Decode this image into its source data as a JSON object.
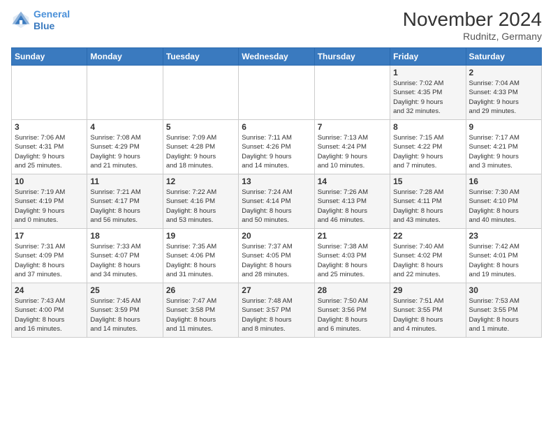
{
  "logo": {
    "line1": "General",
    "line2": "Blue"
  },
  "title": "November 2024",
  "location": "Rudnitz, Germany",
  "days_of_week": [
    "Sunday",
    "Monday",
    "Tuesday",
    "Wednesday",
    "Thursday",
    "Friday",
    "Saturday"
  ],
  "weeks": [
    [
      {
        "day": "",
        "info": ""
      },
      {
        "day": "",
        "info": ""
      },
      {
        "day": "",
        "info": ""
      },
      {
        "day": "",
        "info": ""
      },
      {
        "day": "",
        "info": ""
      },
      {
        "day": "1",
        "info": "Sunrise: 7:02 AM\nSunset: 4:35 PM\nDaylight: 9 hours\nand 32 minutes."
      },
      {
        "day": "2",
        "info": "Sunrise: 7:04 AM\nSunset: 4:33 PM\nDaylight: 9 hours\nand 29 minutes."
      }
    ],
    [
      {
        "day": "3",
        "info": "Sunrise: 7:06 AM\nSunset: 4:31 PM\nDaylight: 9 hours\nand 25 minutes."
      },
      {
        "day": "4",
        "info": "Sunrise: 7:08 AM\nSunset: 4:29 PM\nDaylight: 9 hours\nand 21 minutes."
      },
      {
        "day": "5",
        "info": "Sunrise: 7:09 AM\nSunset: 4:28 PM\nDaylight: 9 hours\nand 18 minutes."
      },
      {
        "day": "6",
        "info": "Sunrise: 7:11 AM\nSunset: 4:26 PM\nDaylight: 9 hours\nand 14 minutes."
      },
      {
        "day": "7",
        "info": "Sunrise: 7:13 AM\nSunset: 4:24 PM\nDaylight: 9 hours\nand 10 minutes."
      },
      {
        "day": "8",
        "info": "Sunrise: 7:15 AM\nSunset: 4:22 PM\nDaylight: 9 hours\nand 7 minutes."
      },
      {
        "day": "9",
        "info": "Sunrise: 7:17 AM\nSunset: 4:21 PM\nDaylight: 9 hours\nand 3 minutes."
      }
    ],
    [
      {
        "day": "10",
        "info": "Sunrise: 7:19 AM\nSunset: 4:19 PM\nDaylight: 9 hours\nand 0 minutes."
      },
      {
        "day": "11",
        "info": "Sunrise: 7:21 AM\nSunset: 4:17 PM\nDaylight: 8 hours\nand 56 minutes."
      },
      {
        "day": "12",
        "info": "Sunrise: 7:22 AM\nSunset: 4:16 PM\nDaylight: 8 hours\nand 53 minutes."
      },
      {
        "day": "13",
        "info": "Sunrise: 7:24 AM\nSunset: 4:14 PM\nDaylight: 8 hours\nand 50 minutes."
      },
      {
        "day": "14",
        "info": "Sunrise: 7:26 AM\nSunset: 4:13 PM\nDaylight: 8 hours\nand 46 minutes."
      },
      {
        "day": "15",
        "info": "Sunrise: 7:28 AM\nSunset: 4:11 PM\nDaylight: 8 hours\nand 43 minutes."
      },
      {
        "day": "16",
        "info": "Sunrise: 7:30 AM\nSunset: 4:10 PM\nDaylight: 8 hours\nand 40 minutes."
      }
    ],
    [
      {
        "day": "17",
        "info": "Sunrise: 7:31 AM\nSunset: 4:09 PM\nDaylight: 8 hours\nand 37 minutes."
      },
      {
        "day": "18",
        "info": "Sunrise: 7:33 AM\nSunset: 4:07 PM\nDaylight: 8 hours\nand 34 minutes."
      },
      {
        "day": "19",
        "info": "Sunrise: 7:35 AM\nSunset: 4:06 PM\nDaylight: 8 hours\nand 31 minutes."
      },
      {
        "day": "20",
        "info": "Sunrise: 7:37 AM\nSunset: 4:05 PM\nDaylight: 8 hours\nand 28 minutes."
      },
      {
        "day": "21",
        "info": "Sunrise: 7:38 AM\nSunset: 4:03 PM\nDaylight: 8 hours\nand 25 minutes."
      },
      {
        "day": "22",
        "info": "Sunrise: 7:40 AM\nSunset: 4:02 PM\nDaylight: 8 hours\nand 22 minutes."
      },
      {
        "day": "23",
        "info": "Sunrise: 7:42 AM\nSunset: 4:01 PM\nDaylight: 8 hours\nand 19 minutes."
      }
    ],
    [
      {
        "day": "24",
        "info": "Sunrise: 7:43 AM\nSunset: 4:00 PM\nDaylight: 8 hours\nand 16 minutes."
      },
      {
        "day": "25",
        "info": "Sunrise: 7:45 AM\nSunset: 3:59 PM\nDaylight: 8 hours\nand 14 minutes."
      },
      {
        "day": "26",
        "info": "Sunrise: 7:47 AM\nSunset: 3:58 PM\nDaylight: 8 hours\nand 11 minutes."
      },
      {
        "day": "27",
        "info": "Sunrise: 7:48 AM\nSunset: 3:57 PM\nDaylight: 8 hours\nand 8 minutes."
      },
      {
        "day": "28",
        "info": "Sunrise: 7:50 AM\nSunset: 3:56 PM\nDaylight: 8 hours\nand 6 minutes."
      },
      {
        "day": "29",
        "info": "Sunrise: 7:51 AM\nSunset: 3:55 PM\nDaylight: 8 hours\nand 4 minutes."
      },
      {
        "day": "30",
        "info": "Sunrise: 7:53 AM\nSunset: 3:55 PM\nDaylight: 8 hours\nand 1 minute."
      }
    ]
  ]
}
